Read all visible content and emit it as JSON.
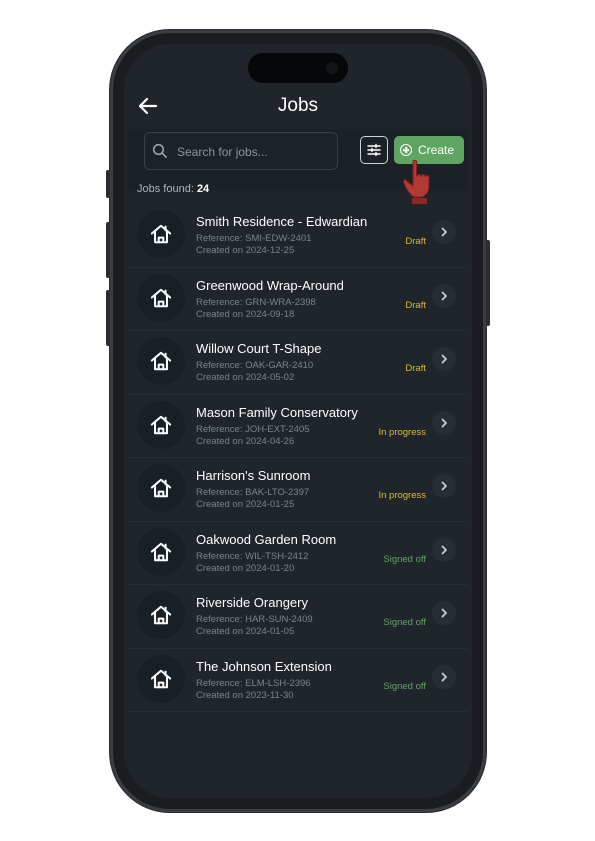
{
  "header": {
    "title": "Jobs"
  },
  "search": {
    "placeholder": "Search for jobs..."
  },
  "toolbar": {
    "create_label": "Create"
  },
  "summary": {
    "label": "Jobs found:",
    "count": "24"
  },
  "colors": {
    "accent": "#5fa562",
    "draft": "#e0b83a",
    "in_progress": "#e0b83a",
    "signed_off": "#5fa562",
    "background": "#1f252b"
  },
  "icons": {
    "back": "arrow-left-icon",
    "search": "search-icon",
    "filter": "sliders-icon",
    "create": "plus-circle-icon",
    "job": "house-icon",
    "row": "chevron-right-icon"
  },
  "jobs": [
    {
      "name": "Smith Residence - Edwardian",
      "reference": "Reference: SMI-EDW-2401",
      "created": "Created on 2024-12-25",
      "status": "Draft",
      "status_type": "draft"
    },
    {
      "name": "Greenwood Wrap-Around",
      "reference": "Reference: GRN-WRA-2398",
      "created": "Created on 2024-09-18",
      "status": "Draft",
      "status_type": "draft"
    },
    {
      "name": "Willow Court T-Shape",
      "reference": "Reference: OAK-GAR-2410",
      "created": "Created on 2024-05-02",
      "status": "Draft",
      "status_type": "draft"
    },
    {
      "name": "Mason Family Conservatory",
      "reference": "Reference: JOH-EXT-2405",
      "created": "Created on 2024-04-26",
      "status": "In progress",
      "status_type": "progress"
    },
    {
      "name": "Harrison's Sunroom",
      "reference": "Reference: BAK-LTO-2397",
      "created": "Created on 2024-01-25",
      "status": "In progress",
      "status_type": "progress"
    },
    {
      "name": "Oakwood Garden Room",
      "reference": "Reference: WIL-TSH-2412",
      "created": "Created on 2024-01-20",
      "status": "Signed off",
      "status_type": "signed"
    },
    {
      "name": "Riverside Orangery",
      "reference": "Reference: HAR-SUN-2409",
      "created": "Created on 2024-01-05",
      "status": "Signed off",
      "status_type": "signed"
    },
    {
      "name": "The Johnson Extension",
      "reference": "Reference: ELM-LSH-2396",
      "created": "Created on 2023-11-30",
      "status": "Signed off",
      "status_type": "signed"
    }
  ]
}
